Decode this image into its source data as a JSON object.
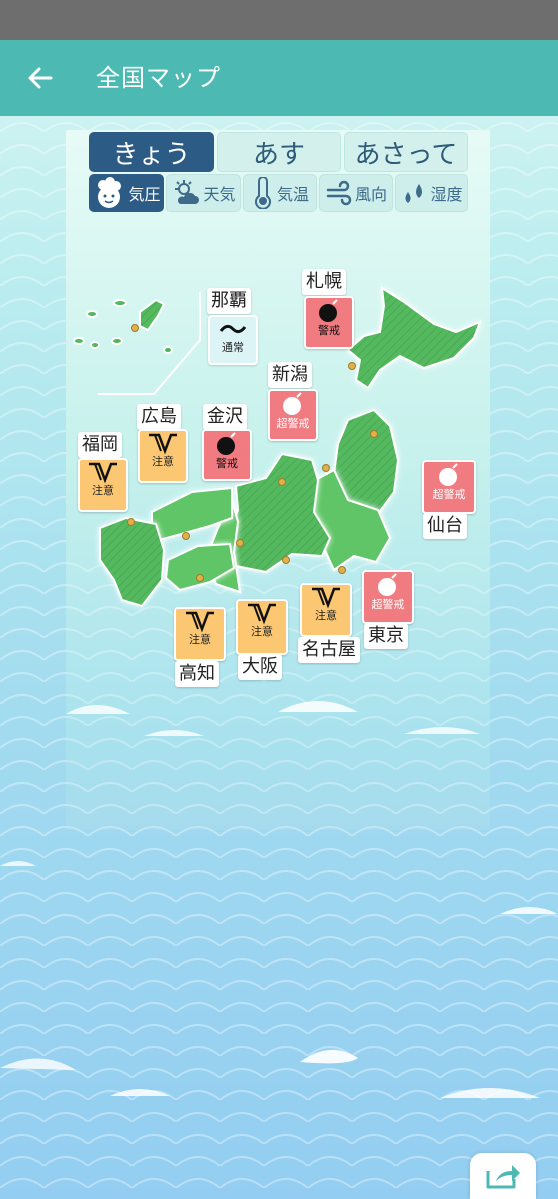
{
  "header": {
    "title": "全国マップ",
    "back_icon": "arrow-left-icon"
  },
  "day_tabs": [
    {
      "label": "きょう",
      "active": true
    },
    {
      "label": "あす",
      "active": false
    },
    {
      "label": "あさって",
      "active": false
    }
  ],
  "mode_tabs": [
    {
      "label": "気圧",
      "icon": "mascot-icon",
      "active": true
    },
    {
      "label": "天気",
      "icon": "sun-cloud-icon",
      "active": false
    },
    {
      "label": "気温",
      "icon": "thermometer-icon",
      "active": false
    },
    {
      "label": "風向",
      "icon": "wind-icon",
      "active": false
    },
    {
      "label": "湿度",
      "icon": "droplets-icon",
      "active": false
    }
  ],
  "regions": [
    {
      "city": "札幌",
      "level": "警戒",
      "icon": "bomb-icon"
    },
    {
      "city": "那覇",
      "level": "通常",
      "icon": "tilde-icon"
    },
    {
      "city": "新潟",
      "level": "超警戒",
      "icon": "bomb-icon"
    },
    {
      "city": "広島",
      "level": "注意",
      "icon": "wave-icon"
    },
    {
      "city": "金沢",
      "level": "警戒",
      "icon": "bomb-icon"
    },
    {
      "city": "福岡",
      "level": "注意",
      "icon": "wave-icon"
    },
    {
      "city": "仙台",
      "level": "超警戒",
      "icon": "bomb-icon"
    },
    {
      "city": "東京",
      "level": "超警戒",
      "icon": "bomb-icon"
    },
    {
      "city": "名古屋",
      "level": "注意",
      "icon": "wave-icon"
    },
    {
      "city": "大阪",
      "level": "注意",
      "icon": "wave-icon"
    },
    {
      "city": "高知",
      "level": "注意",
      "icon": "wave-icon"
    }
  ],
  "share_icon": "share-icon",
  "colors": {
    "appbar": "#4cbab3",
    "active_tab": "#2c5b85",
    "super_warning": "#f07b80",
    "caution": "#fbc772",
    "land": "#4fb559"
  }
}
